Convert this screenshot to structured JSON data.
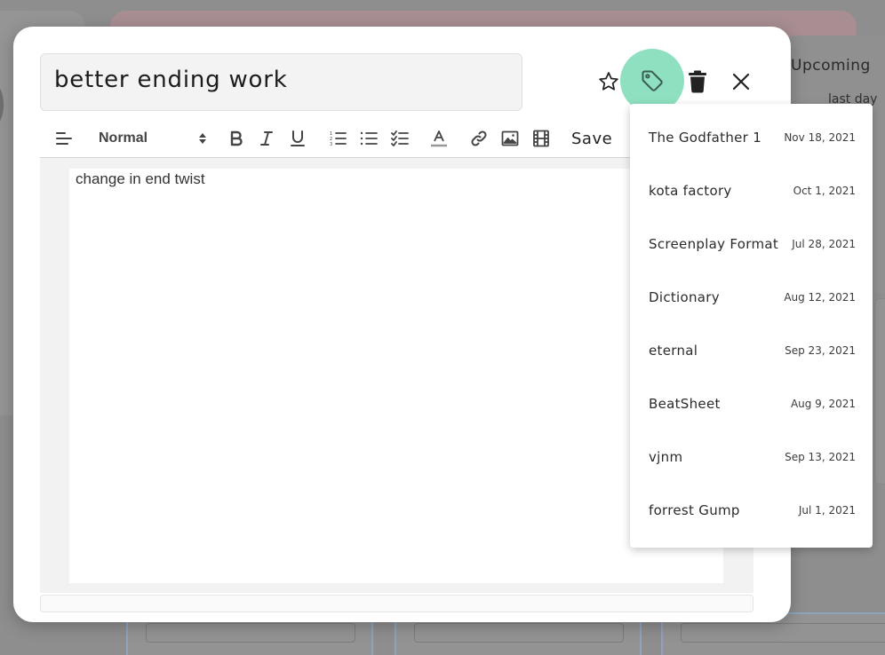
{
  "background": {
    "panel_title": "Upcoming",
    "panel_subtitle": "last day"
  },
  "note": {
    "title": "better ending work",
    "body": "change in end twist"
  },
  "toolbar": {
    "format_value": "Normal",
    "save_label": "Save"
  },
  "colors": {
    "tag_highlight": "#8ee0c0",
    "modal_bg": "#ffffff",
    "overlay": "#8f8f8f"
  },
  "tag_menu": {
    "items": [
      {
        "name": "The Godfather 1",
        "date": "Nov 18, 2021"
      },
      {
        "name": "kota factory",
        "date": "Oct 1, 2021"
      },
      {
        "name": "Screenplay Format",
        "date": "Jul 28, 2021"
      },
      {
        "name": "Dictionary",
        "date": "Aug 12, 2021"
      },
      {
        "name": "eternal",
        "date": "Sep 23, 2021"
      },
      {
        "name": "BeatSheet",
        "date": "Aug 9, 2021"
      },
      {
        "name": "vjnm",
        "date": "Sep 13, 2021"
      },
      {
        "name": "forrest Gump",
        "date": "Jul 1, 2021"
      }
    ]
  }
}
